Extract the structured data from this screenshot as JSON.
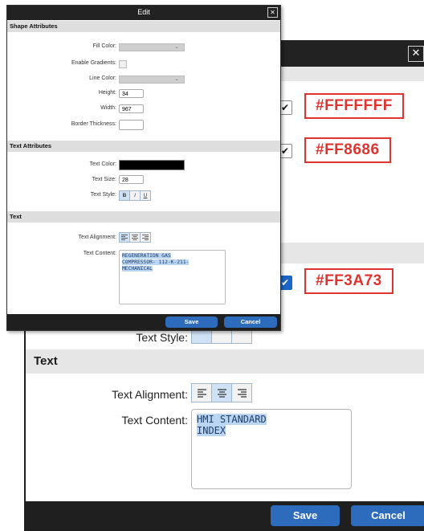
{
  "back_dialog": {
    "close_glyph": "✕",
    "check_glyph": "✔",
    "hex_fill": "#FFFFFFF",
    "hex_text": "#FF8686",
    "hex_blue": "#FF3A73",
    "text_style_label": "Text Style:",
    "text_section_title": "Text",
    "text_alignment_label": "Text Alignment:",
    "text_content_label": "Text Content:",
    "text_content_line1": "HMI STANDARD",
    "text_content_line2": "INDEX",
    "save_label": "Save",
    "cancel_label": "Cancel"
  },
  "edit_dialog": {
    "title": "Edit",
    "close_glyph": "✕",
    "shape_section": "Shape Attributes",
    "fill_color_label": "Fill Color:",
    "enable_gradients_label": "Enable Gradients:",
    "line_color_label": "Line Color:",
    "height_label": "Height:",
    "height_value": "34",
    "width_label": "Width:",
    "width_value": "967",
    "border_thickness_label": "Border Thickness:",
    "text_attr_section": "Text Attributes",
    "text_color_label": "Text Color:",
    "text_color_value": "#000000",
    "text_size_label": "Text Size:",
    "text_size_value": "28",
    "text_style_label": "Text Style:",
    "style_bold": "B",
    "style_italic": "I",
    "style_underline": "U",
    "text_section": "Text",
    "text_alignment_label": "Text Alignment:",
    "text_content_label": "Text Content:",
    "text_content_line1": "REGENERATION GAS",
    "text_content_line2": "COMPRESSOR- 112-K-211-",
    "text_content_line3": "MECHANICAL",
    "save_label": "Save",
    "cancel_label": "Cancel"
  },
  "colors": {
    "accent_blue": "#2d6bbd",
    "annotation_red": "#e0332f",
    "titlebar": "#222222"
  }
}
